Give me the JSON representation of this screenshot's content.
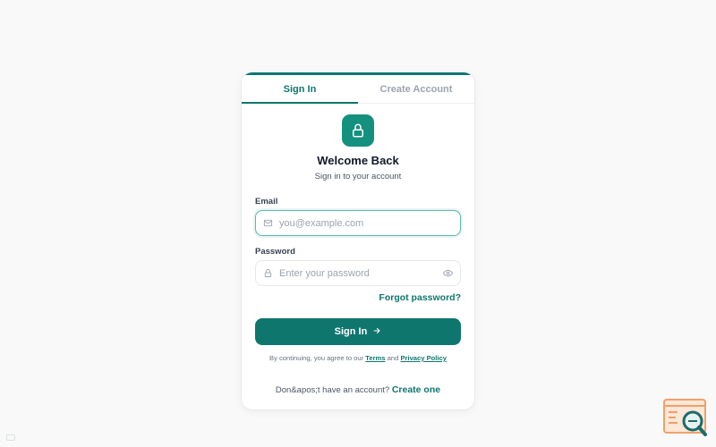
{
  "tabs": {
    "signin_label": "Sign In",
    "create_label": "Create Account"
  },
  "header": {
    "title": "Welcome Back",
    "subtitle": "Sign in to your account"
  },
  "form": {
    "email_label": "Email",
    "email_placeholder": "you@example.com",
    "email_value": "",
    "password_label": "Password",
    "password_placeholder": "Enter your password",
    "password_value": "",
    "forgot_label": "Forgot password?",
    "submit_label": "Sign In"
  },
  "terms": {
    "prefix": "By continuing, you agree to our",
    "terms_link": "Terms",
    "and": "and",
    "privacy_link": "Privacy Policy"
  },
  "footer": {
    "prompt": "Don&apos;t have an account?",
    "create_link": "Create one"
  },
  "icons": {
    "logo": "lock-icon",
    "email": "mail-icon",
    "password": "lock-icon",
    "visibility": "eye-icon",
    "submit": "arrow-right-icon",
    "widget": "bug-report-icon"
  },
  "colors": {
    "accent": "#0f766e",
    "logo_bg": "#14907f",
    "background": "#f8f9f8",
    "widget_orange": "#f0a06a",
    "widget_teal": "#1d6b6b"
  }
}
